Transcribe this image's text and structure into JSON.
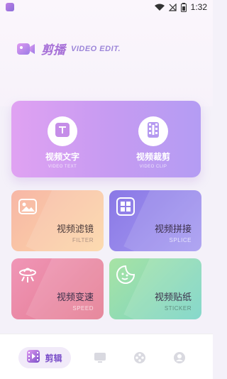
{
  "status": {
    "time": "1:32"
  },
  "brand": {
    "name": "剪播",
    "subtitle": "VIDEO EDIT."
  },
  "hero": [
    {
      "label": "视频文字",
      "sub": "VIDEO TEXT",
      "icon": "text-icon"
    },
    {
      "label": "视频裁剪",
      "sub": "VIDEO CLIP",
      "icon": "film-clip-icon"
    }
  ],
  "cards": [
    {
      "label": "视频滤镜",
      "sub": "FILTER",
      "icon": "image-icon"
    },
    {
      "label": "视频拼接",
      "sub": "SPLICE",
      "icon": "splice-icon"
    },
    {
      "label": "视频变速",
      "sub": "SPEED",
      "icon": "ufo-icon"
    },
    {
      "label": "视频贴纸",
      "sub": "STICKER",
      "icon": "sticker-icon"
    }
  ],
  "nav": {
    "active_label": "剪辑",
    "items": [
      "clip-icon",
      "screen-icon",
      "film-reel-icon",
      "profile-icon"
    ]
  },
  "colors": {
    "accent": "#a66fd7",
    "nav_active": "#7b4fc9"
  }
}
